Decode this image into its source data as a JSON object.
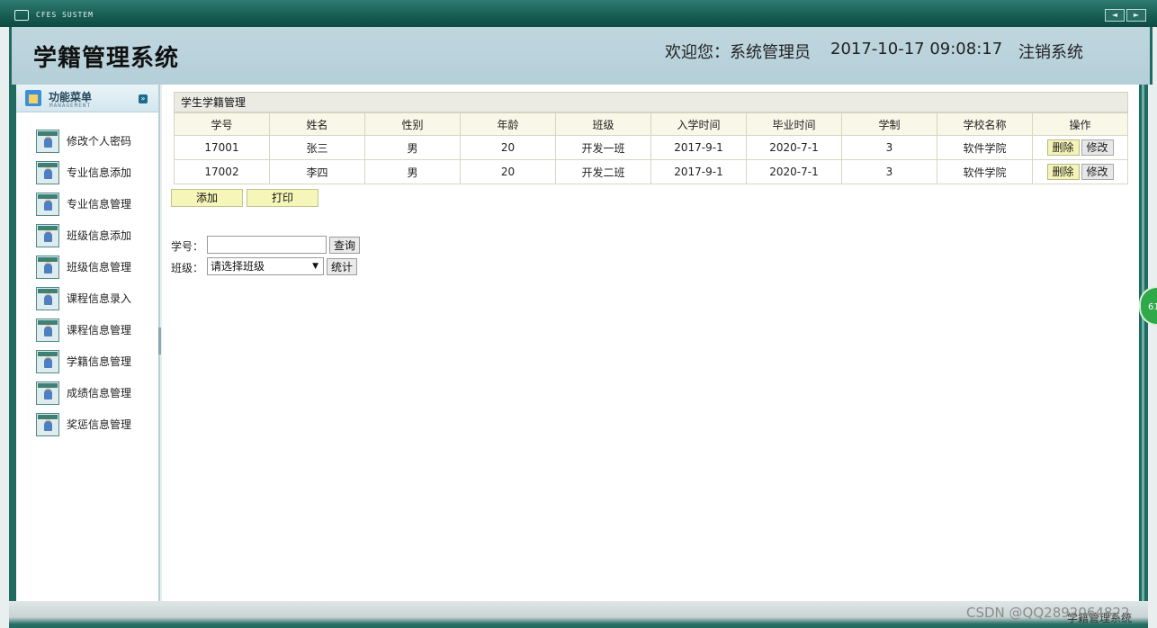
{
  "window": {
    "system_label": "CFES SUSTEM",
    "nav_prev": "◄",
    "nav_next": "►"
  },
  "header": {
    "title": "学籍管理系统",
    "welcome": "欢迎您：系统管理员",
    "datetime": "2017-10-17 09:08:17",
    "logout": "注销系统"
  },
  "sidebar": {
    "title": "功能菜单",
    "subtitle": "MANAGEMENT",
    "toggle": "»",
    "items": [
      {
        "label": "修改个人密码"
      },
      {
        "label": "专业信息添加"
      },
      {
        "label": "专业信息管理"
      },
      {
        "label": "班级信息添加"
      },
      {
        "label": "班级信息管理"
      },
      {
        "label": "课程信息录入"
      },
      {
        "label": "课程信息管理"
      },
      {
        "label": "学籍信息管理"
      },
      {
        "label": "成绩信息管理"
      },
      {
        "label": "奖惩信息管理"
      }
    ]
  },
  "panel": {
    "title": "学生学籍管理"
  },
  "table": {
    "columns": [
      "学号",
      "姓名",
      "性别",
      "年龄",
      "班级",
      "入学时间",
      "毕业时间",
      "学制",
      "学校名称",
      "操作"
    ],
    "rows": [
      {
        "id": "17001",
        "name": "张三",
        "gender": "男",
        "age": "20",
        "class": "开发一班",
        "enroll": "2017-9-1",
        "graduate": "2020-7-1",
        "years": "3",
        "school": "软件学院"
      },
      {
        "id": "17002",
        "name": "李四",
        "gender": "男",
        "age": "20",
        "class": "开发二班",
        "enroll": "2017-9-1",
        "graduate": "2020-7-1",
        "years": "3",
        "school": "软件学院"
      }
    ],
    "delete_label": "删除",
    "edit_label": "修改"
  },
  "actions": {
    "add": "添加",
    "print": "打印"
  },
  "query": {
    "id_label": "学号：",
    "id_value": "",
    "search_button": "查询",
    "class_label": "班级：",
    "class_selected": "请选择班级",
    "stats_button": "统计"
  },
  "bubble": {
    "text": "61"
  },
  "footer": {
    "watermark": "CSDN @QQ2892064822",
    "app_name": "学籍管理系统"
  }
}
